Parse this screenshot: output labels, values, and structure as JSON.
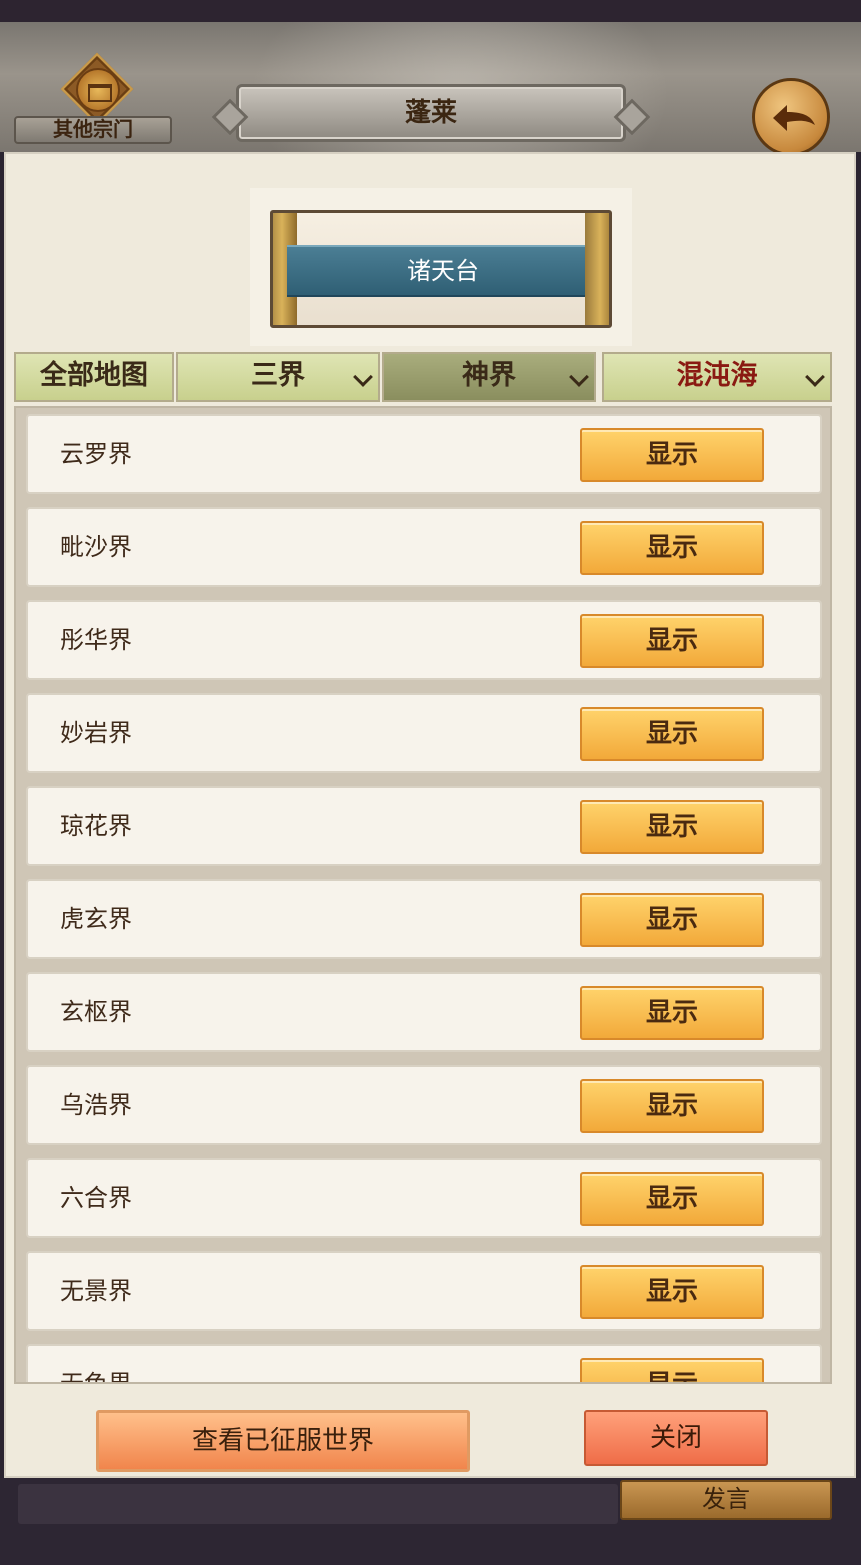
{
  "header": {
    "other_sects_label": "其他宗门",
    "title": "蓬莱"
  },
  "banner": {
    "title": "诸天台"
  },
  "filters": {
    "all": "全部地图",
    "sanjie": "三界",
    "shenjie": "神界",
    "hundun": "混沌海"
  },
  "list": {
    "button_label": "显示",
    "items": [
      {
        "name": "云罗界"
      },
      {
        "name": "毗沙界"
      },
      {
        "name": "彤华界"
      },
      {
        "name": "妙岩界"
      },
      {
        "name": "琼花界"
      },
      {
        "name": "虎玄界"
      },
      {
        "name": "玄枢界"
      },
      {
        "name": "乌浩界"
      },
      {
        "name": "六合界"
      },
      {
        "name": "无景界"
      },
      {
        "name": "无色界"
      }
    ]
  },
  "footer_buttons": {
    "conquered": "查看已征服世界",
    "close": "关闭"
  },
  "chat": {
    "speak": "发言"
  },
  "icons": [
    "sect-emblem-icon",
    "back-arrow-icon",
    "chevron-down-icon"
  ]
}
